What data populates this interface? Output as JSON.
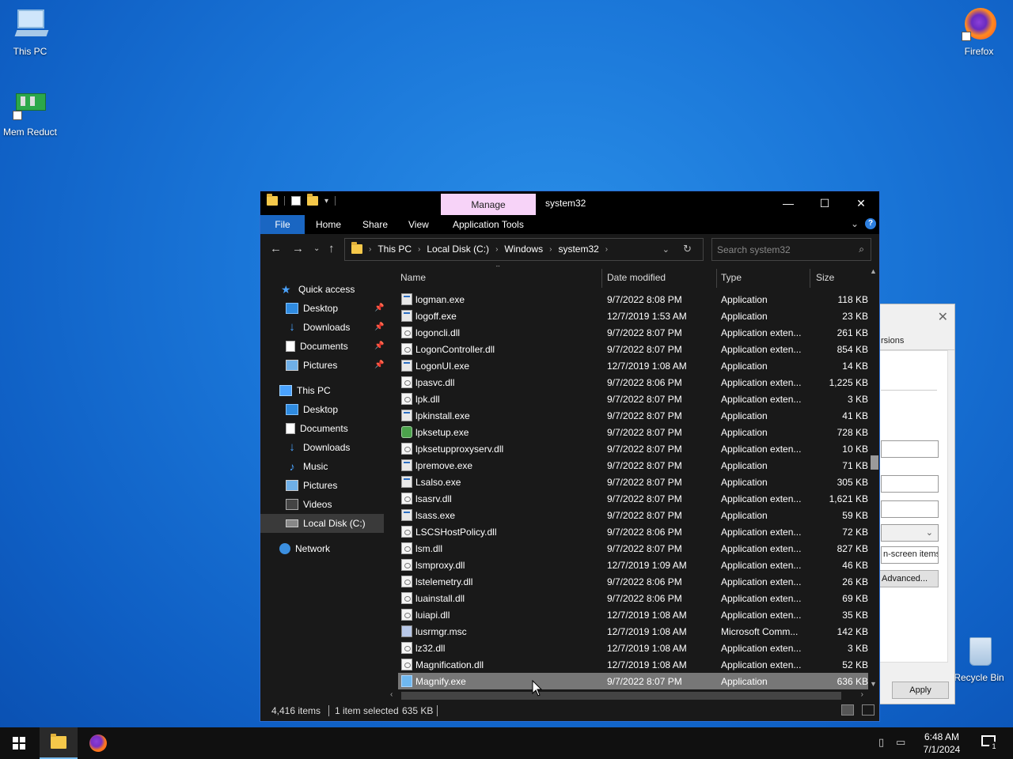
{
  "desktop": {
    "icons": [
      {
        "label": "This PC"
      },
      {
        "label": "Mem Reduct"
      },
      {
        "label": "Firefox"
      },
      {
        "label": "Recycle Bin"
      }
    ]
  },
  "background_dialog": {
    "tab_fragment": "rsions",
    "field_text": "n-screen items f",
    "advanced_label": "Advanced...",
    "apply_label": "Apply"
  },
  "explorer": {
    "title": "system32",
    "manage_tab": "Manage",
    "ribbon_tabs": [
      "File",
      "Home",
      "Share",
      "View",
      "Application Tools"
    ],
    "breadcrumb": [
      "This PC",
      "Local Disk (C:)",
      "Windows",
      "system32"
    ],
    "search_placeholder": "Search system32",
    "nav": {
      "quick_access": "Quick access",
      "quick_items": [
        "Desktop",
        "Downloads",
        "Documents",
        "Pictures"
      ],
      "this_pc": "This PC",
      "pc_items": [
        "Desktop",
        "Documents",
        "Downloads",
        "Music",
        "Pictures",
        "Videos",
        "Local Disk (C:)"
      ],
      "network": "Network"
    },
    "columns": {
      "name": "Name",
      "date": "Date modified",
      "type": "Type",
      "size": "Size"
    },
    "files": [
      {
        "name": "logman.exe",
        "date": "9/7/2022 8:08 PM",
        "type": "Application",
        "size": "118 KB",
        "icon": "exe"
      },
      {
        "name": "logoff.exe",
        "date": "12/7/2019 1:53 AM",
        "type": "Application",
        "size": "23 KB",
        "icon": "exe"
      },
      {
        "name": "logoncli.dll",
        "date": "9/7/2022 8:07 PM",
        "type": "Application exten...",
        "size": "261 KB",
        "icon": "dll"
      },
      {
        "name": "LogonController.dll",
        "date": "9/7/2022 8:07 PM",
        "type": "Application exten...",
        "size": "854 KB",
        "icon": "dll"
      },
      {
        "name": "LogonUI.exe",
        "date": "12/7/2019 1:08 AM",
        "type": "Application",
        "size": "14 KB",
        "icon": "exe"
      },
      {
        "name": "lpasvc.dll",
        "date": "9/7/2022 8:06 PM",
        "type": "Application exten...",
        "size": "1,225 KB",
        "icon": "dll"
      },
      {
        "name": "lpk.dll",
        "date": "9/7/2022 8:07 PM",
        "type": "Application exten...",
        "size": "3 KB",
        "icon": "dll"
      },
      {
        "name": "lpkinstall.exe",
        "date": "9/7/2022 8:07 PM",
        "type": "Application",
        "size": "41 KB",
        "icon": "exe"
      },
      {
        "name": "lpksetup.exe",
        "date": "9/7/2022 8:07 PM",
        "type": "Application",
        "size": "728 KB",
        "icon": "setup"
      },
      {
        "name": "lpksetupproxyserv.dll",
        "date": "9/7/2022 8:07 PM",
        "type": "Application exten...",
        "size": "10 KB",
        "icon": "dll"
      },
      {
        "name": "lpremove.exe",
        "date": "9/7/2022 8:07 PM",
        "type": "Application",
        "size": "71 KB",
        "icon": "exe"
      },
      {
        "name": "Lsalso.exe",
        "date": "9/7/2022 8:07 PM",
        "type": "Application",
        "size": "305 KB",
        "icon": "exe"
      },
      {
        "name": "lsasrv.dll",
        "date": "9/7/2022 8:07 PM",
        "type": "Application exten...",
        "size": "1,621 KB",
        "icon": "dll"
      },
      {
        "name": "lsass.exe",
        "date": "9/7/2022 8:07 PM",
        "type": "Application",
        "size": "59 KB",
        "icon": "exe"
      },
      {
        "name": "LSCSHostPolicy.dll",
        "date": "9/7/2022 8:06 PM",
        "type": "Application exten...",
        "size": "72 KB",
        "icon": "dll"
      },
      {
        "name": "lsm.dll",
        "date": "9/7/2022 8:07 PM",
        "type": "Application exten...",
        "size": "827 KB",
        "icon": "dll"
      },
      {
        "name": "lsmproxy.dll",
        "date": "12/7/2019 1:09 AM",
        "type": "Application exten...",
        "size": "46 KB",
        "icon": "dll"
      },
      {
        "name": "lstelemetry.dll",
        "date": "9/7/2022 8:06 PM",
        "type": "Application exten...",
        "size": "26 KB",
        "icon": "dll"
      },
      {
        "name": "luainstall.dll",
        "date": "9/7/2022 8:06 PM",
        "type": "Application exten...",
        "size": "69 KB",
        "icon": "dll"
      },
      {
        "name": "luiapi.dll",
        "date": "12/7/2019 1:08 AM",
        "type": "Application exten...",
        "size": "35 KB",
        "icon": "dll"
      },
      {
        "name": "lusrmgr.msc",
        "date": "12/7/2019 1:08 AM",
        "type": "Microsoft Comm...",
        "size": "142 KB",
        "icon": "msc"
      },
      {
        "name": "lz32.dll",
        "date": "12/7/2019 1:08 AM",
        "type": "Application exten...",
        "size": "3 KB",
        "icon": "dll"
      },
      {
        "name": "Magnification.dll",
        "date": "12/7/2019 1:08 AM",
        "type": "Application exten...",
        "size": "52 KB",
        "icon": "dll"
      },
      {
        "name": "Magnify.exe",
        "date": "9/7/2022 8:07 PM",
        "type": "Application",
        "size": "636 KB",
        "icon": "mag",
        "selected": true
      }
    ],
    "status": {
      "items": "4,416 items",
      "selected": "1 item selected",
      "size": "635 KB"
    }
  },
  "taskbar": {
    "time": "6:48 AM",
    "date": "7/1/2024",
    "notification_count": "1"
  }
}
